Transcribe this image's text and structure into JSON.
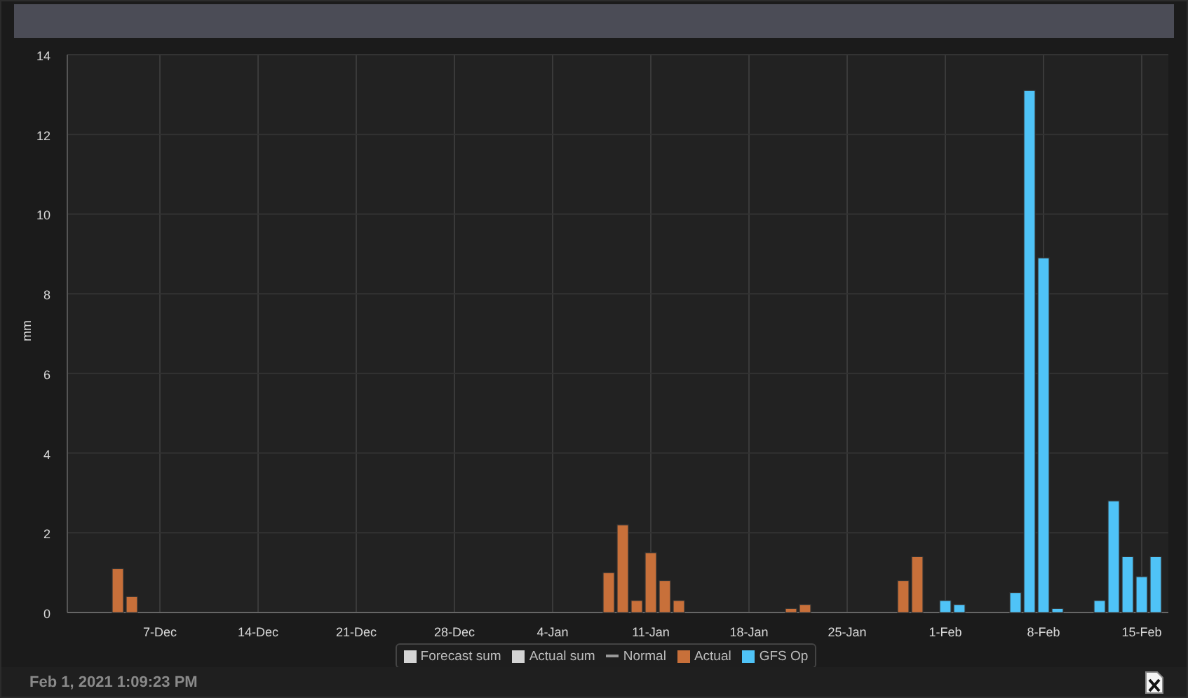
{
  "chart_panel": {
    "chart_data": {
      "type": "bar",
      "grid": true,
      "ylabel": "mm",
      "ylim": [
        0,
        14
      ],
      "yticks": [
        0,
        2,
        4,
        6,
        8,
        10,
        12,
        14
      ],
      "categories": [
        null,
        null,
        null,
        null,
        null,
        null,
        "7-Dec",
        null,
        null,
        null,
        null,
        null,
        null,
        "14-Dec",
        null,
        null,
        null,
        null,
        null,
        null,
        "21-Dec",
        null,
        null,
        null,
        null,
        null,
        null,
        "28-Dec",
        null,
        null,
        null,
        null,
        null,
        null,
        "4-Jan",
        null,
        null,
        null,
        null,
        null,
        null,
        "11-Jan",
        null,
        null,
        null,
        null,
        null,
        null,
        "18-Jan",
        null,
        null,
        null,
        null,
        null,
        null,
        "25-Jan",
        null,
        null,
        null,
        null,
        null,
        null,
        "1-Feb",
        null,
        null,
        null,
        null,
        null,
        null,
        "8-Feb",
        null,
        null,
        null,
        null,
        null,
        null,
        "15-Feb",
        null
      ],
      "series": [
        {
          "name": "Actual",
          "color": "#c8703a",
          "values": [
            null,
            null,
            null,
            1.1,
            0.4,
            null,
            null,
            null,
            null,
            null,
            null,
            null,
            null,
            null,
            null,
            null,
            null,
            null,
            null,
            null,
            null,
            null,
            null,
            null,
            null,
            null,
            null,
            null,
            null,
            null,
            null,
            null,
            null,
            null,
            null,
            null,
            null,
            null,
            1.0,
            2.2,
            0.3,
            1.5,
            0.8,
            0.3,
            null,
            null,
            null,
            null,
            null,
            null,
            null,
            0.1,
            0.2,
            null,
            null,
            null,
            null,
            null,
            null,
            0.8,
            1.4,
            null,
            null,
            null,
            null,
            null,
            null,
            null,
            null,
            null,
            null,
            null,
            null,
            null,
            null,
            null,
            null,
            null
          ]
        },
        {
          "name": "GFS Op",
          "color": "#4fc3f7",
          "values": [
            null,
            null,
            null,
            null,
            null,
            null,
            null,
            null,
            null,
            null,
            null,
            null,
            null,
            null,
            null,
            null,
            null,
            null,
            null,
            null,
            null,
            null,
            null,
            null,
            null,
            null,
            null,
            null,
            null,
            null,
            null,
            null,
            null,
            null,
            null,
            null,
            null,
            null,
            null,
            null,
            null,
            null,
            null,
            null,
            null,
            null,
            null,
            null,
            null,
            null,
            null,
            null,
            null,
            null,
            null,
            null,
            null,
            null,
            null,
            null,
            null,
            null,
            0.3,
            0.2,
            null,
            null,
            null,
            0.5,
            13.1,
            8.9,
            0.1,
            null,
            null,
            0.3,
            2.8,
            1.4,
            0.9,
            1.4
          ]
        }
      ]
    },
    "legend_extra": [
      {
        "label": "Forecast sum",
        "kind": "square",
        "color": "#d4d4d4"
      },
      {
        "label": "Actual sum",
        "kind": "square",
        "color": "#d4d4d4"
      },
      {
        "label": "Normal",
        "kind": "line",
        "color": "#9a9a9a"
      }
    ]
  },
  "footer": {
    "timestamp": "Feb 1, 2021 1:09:23 PM"
  }
}
